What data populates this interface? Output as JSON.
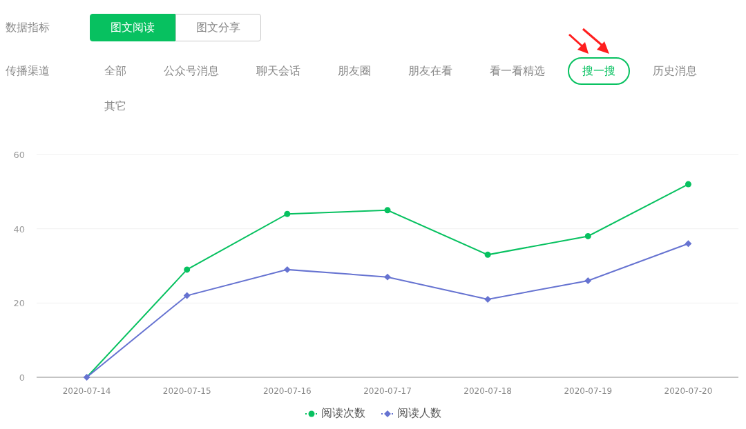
{
  "metric_filter": {
    "label": "数据指标",
    "options": [
      {
        "label": "图文阅读",
        "selected": true
      },
      {
        "label": "图文分享",
        "selected": false
      }
    ]
  },
  "channel_filter": {
    "label": "传播渠道",
    "options": [
      {
        "label": "全部",
        "selected": false
      },
      {
        "label": "公众号消息",
        "selected": false
      },
      {
        "label": "聊天会话",
        "selected": false
      },
      {
        "label": "朋友圈",
        "selected": false
      },
      {
        "label": "朋友在看",
        "selected": false
      },
      {
        "label": "看一看精选",
        "selected": false
      },
      {
        "label": "搜一搜",
        "selected": true
      },
      {
        "label": "历史消息",
        "selected": false
      },
      {
        "label": "其它",
        "selected": false
      }
    ]
  },
  "chart": {
    "chart_data": {
      "type": "line",
      "categories": [
        "2020-07-14",
        "2020-07-15",
        "2020-07-16",
        "2020-07-17",
        "2020-07-18",
        "2020-07-19",
        "2020-07-20"
      ],
      "ylim": [
        0,
        60
      ],
      "legend": "bottom",
      "yticks": [
        0,
        20,
        40,
        60
      ],
      "series": [
        {
          "name": "阅读次数",
          "color": "#07c160",
          "marker": "circle",
          "values": [
            0,
            29,
            44,
            45,
            33,
            38,
            52
          ]
        },
        {
          "name": "阅读人数",
          "color": "#6673d1",
          "marker": "diamond",
          "values": [
            0,
            22,
            29,
            27,
            21,
            26,
            36
          ]
        }
      ]
    }
  }
}
